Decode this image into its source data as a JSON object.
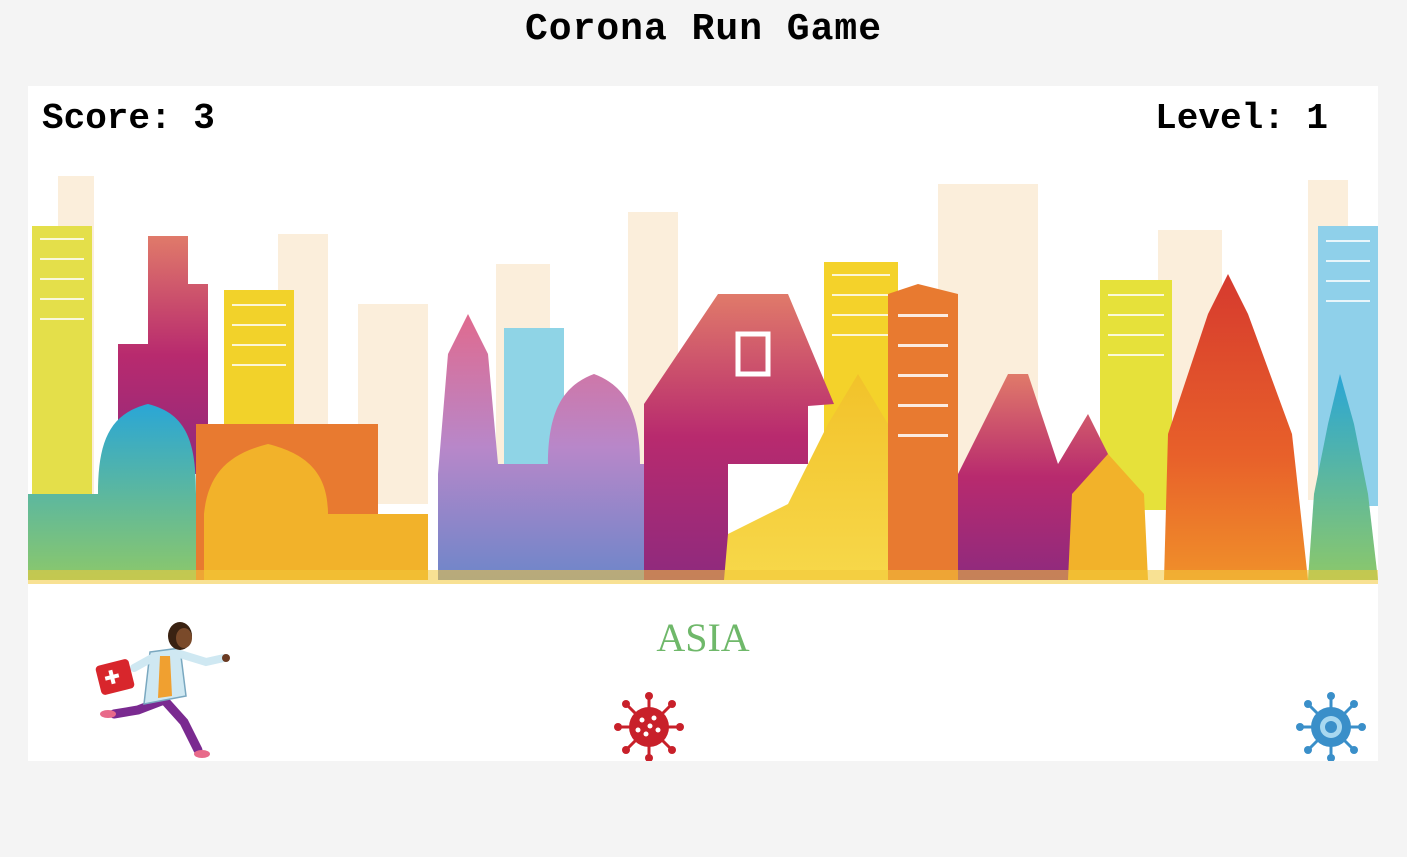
{
  "title": "Corona Run Game",
  "hud": {
    "score_text": "Score: 3",
    "level_text": "Level: 1",
    "score": 3,
    "level": 1
  },
  "scene": {
    "region_label": "ASIA"
  },
  "sprites": {
    "player": "doctor-runner-icon",
    "enemies": [
      {
        "name": "virus-red-icon",
        "color": "#c8202a"
      },
      {
        "name": "virus-blue-icon",
        "color": "#3a8fc9"
      }
    ]
  },
  "colors": {
    "page_bg": "#f4f4f4",
    "canvas_bg": "#ffffff",
    "region_label": "#6fb86a"
  }
}
